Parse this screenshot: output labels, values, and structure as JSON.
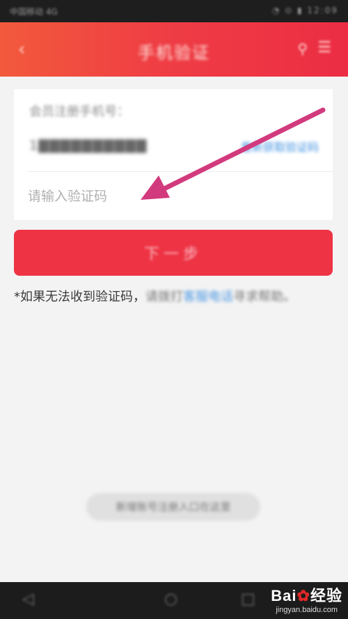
{
  "status_bar": {
    "left_text": "中国移动 4G",
    "right_text": "◔ ⊙ ▮ 12:09"
  },
  "header": {
    "title": "手机验证",
    "back_icon": "back-arrow-icon",
    "search_icon": "search-icon",
    "menu_icon": "menu-icon"
  },
  "verification": {
    "prompt": "会员注册手机号：",
    "phone_masked": "1▇▇▇▇▇▇▇▇▇▇",
    "resend_label": "重新获取验证码",
    "code_placeholder": "请输入验证码",
    "code_value": ""
  },
  "next_button_label": "下一步",
  "help": {
    "lead": "*如果无法收到验证码，",
    "blurred_mid": "请拨打",
    "link": "客服电话",
    "tail": "寻求帮助。"
  },
  "bottom_pill_label": "新增账号注册入口在这里",
  "nav": {
    "back_icon": "nav-back-icon",
    "home_icon": "nav-home-icon",
    "recent_icon": "nav-recent-icon"
  },
  "watermark": {
    "main": "Bai",
    "paw": "✿",
    "du": "经验",
    "sub": "jingyan.baidu.com"
  },
  "colors": {
    "accent_red": "#ee3344",
    "link_blue": "#3d8fe0",
    "annotation_arrow": "#d23a7e"
  }
}
